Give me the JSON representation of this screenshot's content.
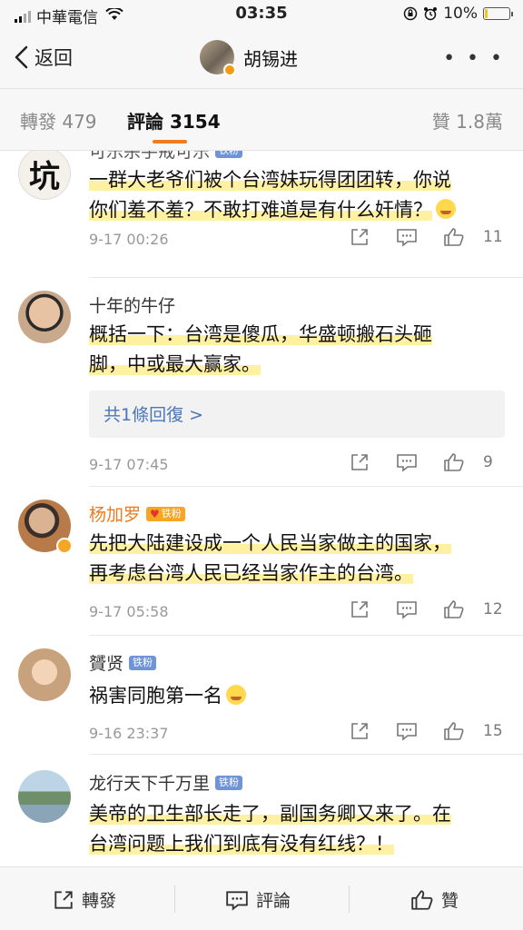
{
  "status_bar": {
    "carrier": "中華電信",
    "time": "03:35",
    "battery": "10%",
    "battery_level": 0.1
  },
  "nav": {
    "back_label": "返回",
    "user_name": "胡锡进",
    "more_label": "• • •"
  },
  "tabs": {
    "repost": "轉發 479",
    "comment": "評論 3154",
    "like": "贊 1.8萬"
  },
  "comments": [
    {
      "user": "可乐杀手戒可乐",
      "badge": "铁粉",
      "text_lines": [
        "一群大老爷们被个台湾妹玩得团团转，你说",
        "你们羞不羞？不敢打难道是有什么奸情？"
      ],
      "time": "9-17 00:26",
      "likes": "11"
    },
    {
      "user": "十年的牛仔",
      "text_lines": [
        "概括一下：台湾是傻瓜，华盛顿搬石头砸",
        "脚，中或最大赢家。"
      ],
      "reply_label": "共1條回復 >",
      "time": "9-17 07:45",
      "likes": "9"
    },
    {
      "user": "杨加罗",
      "badge": "铁粉",
      "text_lines": [
        "先把大陆建设成一个人民当家做主的国家，",
        "再考虑台湾人民已经当家作主的台湾。"
      ],
      "time": "9-17 05:58",
      "likes": "12"
    },
    {
      "user": "贇贤",
      "badge": "铁粉",
      "text_lines": [
        "祸害同胞第一名"
      ],
      "time": "9-16 23:37",
      "likes": "15"
    },
    {
      "user": "龙行天下千万里",
      "badge": "铁粉",
      "text_lines": [
        "美帝的卫生部长走了，副国务卿又来了。在",
        "台湾问题上我们到底有没有红线？！"
      ]
    }
  ],
  "first_avatar_char": "坑",
  "bottom_bar": {
    "repost": "轉發",
    "comment": "評論",
    "like": "贊"
  },
  "colors": {
    "accent": "#f07c22",
    "link": "#4a76b8",
    "badge_blue": "#6e93d6",
    "badge_gold": "#f6a623"
  }
}
